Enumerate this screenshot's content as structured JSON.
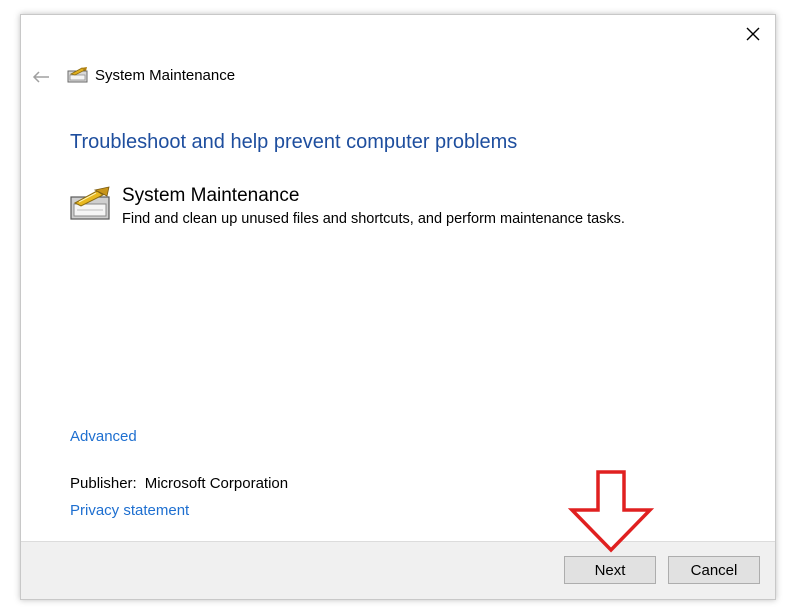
{
  "window": {
    "title": "System Maintenance",
    "close_icon": "close-icon",
    "back_icon": "back-arrow-icon"
  },
  "main": {
    "heading": "Troubleshoot and help prevent computer problems",
    "task": {
      "title": "System Maintenance",
      "description": "Find and clean up unused files and shortcuts, and perform maintenance tasks.",
      "icon": "system-maintenance-icon"
    },
    "advanced_link": "Advanced",
    "publisher_label": "Publisher:",
    "publisher_value": "Microsoft Corporation",
    "privacy_link": "Privacy statement"
  },
  "footer": {
    "next_label": "Next",
    "cancel_label": "Cancel"
  },
  "annotation": {
    "arrow_color": "#e02020",
    "arrow_icon": "red-down-arrow-icon"
  },
  "colors": {
    "heading": "#1e4e9e",
    "link": "#1e6fd0",
    "footer_bg": "#f0f0f0"
  }
}
